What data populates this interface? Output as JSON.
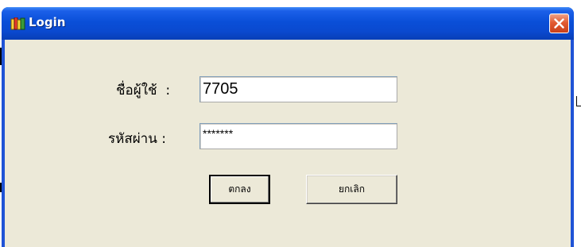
{
  "window": {
    "title": "Login",
    "icon": "books-icon",
    "close_icon": "close-icon"
  },
  "form": {
    "username_label": "ชื่อผู้ใช้  :",
    "username_value": "7705",
    "password_label": "รหัสผ่าน :",
    "password_value": "*******"
  },
  "buttons": {
    "ok_label": "ตกลง",
    "cancel_label": "ยกเลิก"
  },
  "colors": {
    "titlebar": "#0a4fd8",
    "client_background": "#ece9d8",
    "close_button": "#e25b32"
  }
}
